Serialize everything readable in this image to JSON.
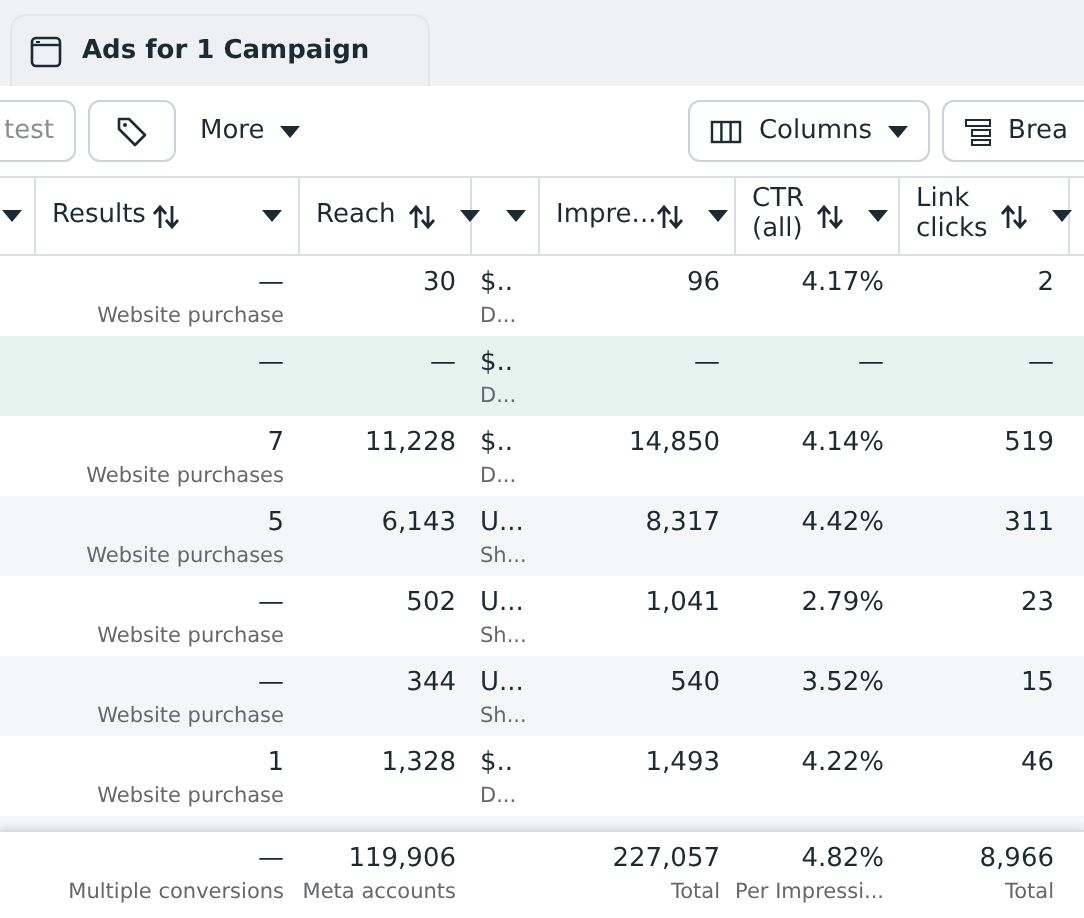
{
  "tab": {
    "title": "Ads for 1 Campaign"
  },
  "toolbar": {
    "search": {
      "placeholder": "test"
    },
    "more": "More",
    "columns": "Columns",
    "breakdown": "Brea"
  },
  "table": {
    "columns": [
      {
        "kind": "menu"
      },
      {
        "kind": "sort",
        "label": "Results"
      },
      {
        "kind": "sort",
        "label": "Reach"
      },
      {
        "kind": "menu"
      },
      {
        "kind": "sort",
        "label": "Impre..."
      },
      {
        "kind": "sort",
        "label": "CTR (all)"
      },
      {
        "kind": "sort",
        "label": "Link clicks"
      }
    ],
    "rows": [
      {
        "selected": false,
        "cells": [
          {
            "value": "—",
            "note": "Website purchase"
          },
          {
            "value": "30"
          },
          {
            "value": "$..",
            "note": "D..."
          },
          {
            "value": "96"
          },
          {
            "value": "4.17%"
          },
          {
            "value": "2"
          }
        ]
      },
      {
        "selected": true,
        "cells": [
          {
            "value": "—"
          },
          {
            "value": "—"
          },
          {
            "value": "$..",
            "note": "D..."
          },
          {
            "value": "—"
          },
          {
            "value": "—"
          },
          {
            "value": "—"
          }
        ]
      },
      {
        "selected": false,
        "cells": [
          {
            "value": "7",
            "note": "Website purchases"
          },
          {
            "value": "11,228"
          },
          {
            "value": "$..",
            "note": "D..."
          },
          {
            "value": "14,850"
          },
          {
            "value": "4.14%"
          },
          {
            "value": "519"
          }
        ]
      },
      {
        "selected": false,
        "cells": [
          {
            "value": "5",
            "note": "Website purchases"
          },
          {
            "value": "6,143"
          },
          {
            "value": "U...",
            "note": "Sh..."
          },
          {
            "value": "8,317"
          },
          {
            "value": "4.42%"
          },
          {
            "value": "311"
          }
        ]
      },
      {
        "selected": false,
        "cells": [
          {
            "value": "—",
            "note": "Website purchase"
          },
          {
            "value": "502"
          },
          {
            "value": "U...",
            "note": "Sh..."
          },
          {
            "value": "1,041"
          },
          {
            "value": "2.79%"
          },
          {
            "value": "23"
          }
        ]
      },
      {
        "selected": false,
        "cells": [
          {
            "value": "—",
            "note": "Website purchase"
          },
          {
            "value": "344"
          },
          {
            "value": "U...",
            "note": "Sh..."
          },
          {
            "value": "540"
          },
          {
            "value": "3.52%"
          },
          {
            "value": "15"
          }
        ]
      },
      {
        "selected": false,
        "cells": [
          {
            "value": "1",
            "note": "Website purchase"
          },
          {
            "value": "1,328"
          },
          {
            "value": "$..",
            "note": "D..."
          },
          {
            "value": "1,493"
          },
          {
            "value": "4.22%"
          },
          {
            "value": "46"
          }
        ]
      }
    ],
    "totals": [
      {
        "kind": "figure",
        "value": "—",
        "note": "Multiple conversions"
      },
      {
        "kind": "figure",
        "value": "119,906",
        "note": "Meta accounts"
      },
      {
        "kind": "blank"
      },
      {
        "kind": "figure",
        "value": "227,057",
        "note": "Total"
      },
      {
        "kind": "figure",
        "value": "4.82%",
        "note": "Per Impressi..."
      },
      {
        "kind": "figure",
        "value": "8,966",
        "note": "Total"
      }
    ]
  }
}
